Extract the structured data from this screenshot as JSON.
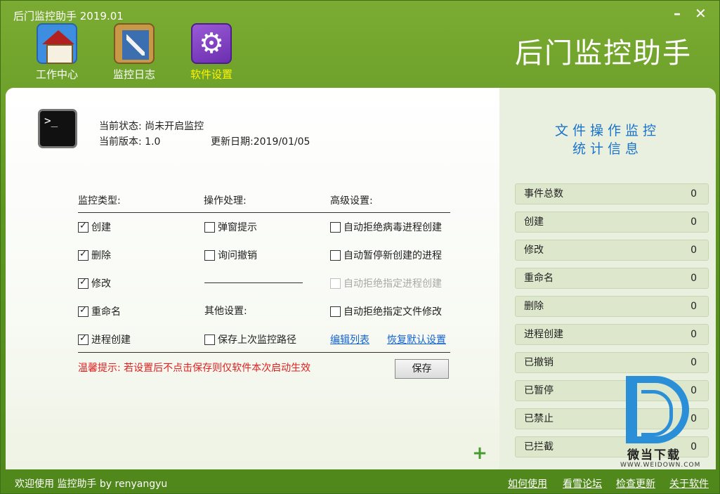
{
  "window": {
    "title": "后门监控助手 2019.01",
    "minimize": "–",
    "close": "✕",
    "brand": "后门监控助手"
  },
  "toolbar": {
    "work_center": "工作中心",
    "monitor_log": "监控日志",
    "settings": "软件设置"
  },
  "status": {
    "state": "当前状态: 尚未开启监控",
    "version": "当前版本: 1.0",
    "update_date": "更新日期:2019/01/05",
    "terminal_glyph": ">_"
  },
  "settings": {
    "monitor_type_header": "监控类型:",
    "operation_header": "操作处理:",
    "advanced_header": "高级设置:",
    "other_header": "其他设置:",
    "monitor_types": [
      {
        "label": "创建",
        "checked": true
      },
      {
        "label": "删除",
        "checked": true
      },
      {
        "label": "修改",
        "checked": true
      },
      {
        "label": "重命名",
        "checked": true
      },
      {
        "label": "进程创建",
        "checked": true
      }
    ],
    "operations": [
      {
        "label": "弹窗提示",
        "checked": false
      },
      {
        "label": "询问撤销",
        "checked": false
      }
    ],
    "other": [
      {
        "label": "保存上次监控路径",
        "checked": false
      }
    ],
    "advanced": [
      {
        "label": "自动拒绝病毒进程创建",
        "checked": false,
        "disabled": false
      },
      {
        "label": "自动暂停新创建的进程",
        "checked": false,
        "disabled": false
      },
      {
        "label": "自动拒绝指定进程创建",
        "checked": false,
        "disabled": true
      },
      {
        "label": "自动拒绝指定文件修改",
        "checked": false,
        "disabled": false
      }
    ],
    "edit_list": "编辑列表",
    "restore_default": "恢复默认设置",
    "tip": "温馨提示: 若设置后不点击保存则仅软件本次启动生效",
    "save": "保存",
    "plus": "+"
  },
  "stats": {
    "title_line1": "文件操作监控",
    "title_line2": "统计信息",
    "rows": [
      {
        "label": "事件总数",
        "value": "0"
      },
      {
        "label": "创建",
        "value": "0"
      },
      {
        "label": "修改",
        "value": "0"
      },
      {
        "label": "重命名",
        "value": "0"
      },
      {
        "label": "删除",
        "value": "0"
      },
      {
        "label": "进程创建",
        "value": "0"
      },
      {
        "label": "已撤销",
        "value": "0"
      },
      {
        "label": "已暂停",
        "value": "0"
      },
      {
        "label": "已禁止",
        "value": "0"
      },
      {
        "label": "已拦截",
        "value": "0"
      }
    ]
  },
  "watermark": {
    "name": "微当下载",
    "url": "WWW.WEIDOWN.COM"
  },
  "footer": {
    "welcome": "欢迎使用 监控助手  by  renyangyu",
    "how_to_use": "如何使用",
    "forum": "看雪论坛",
    "check_update": "检查更新",
    "about": "关于软件"
  }
}
